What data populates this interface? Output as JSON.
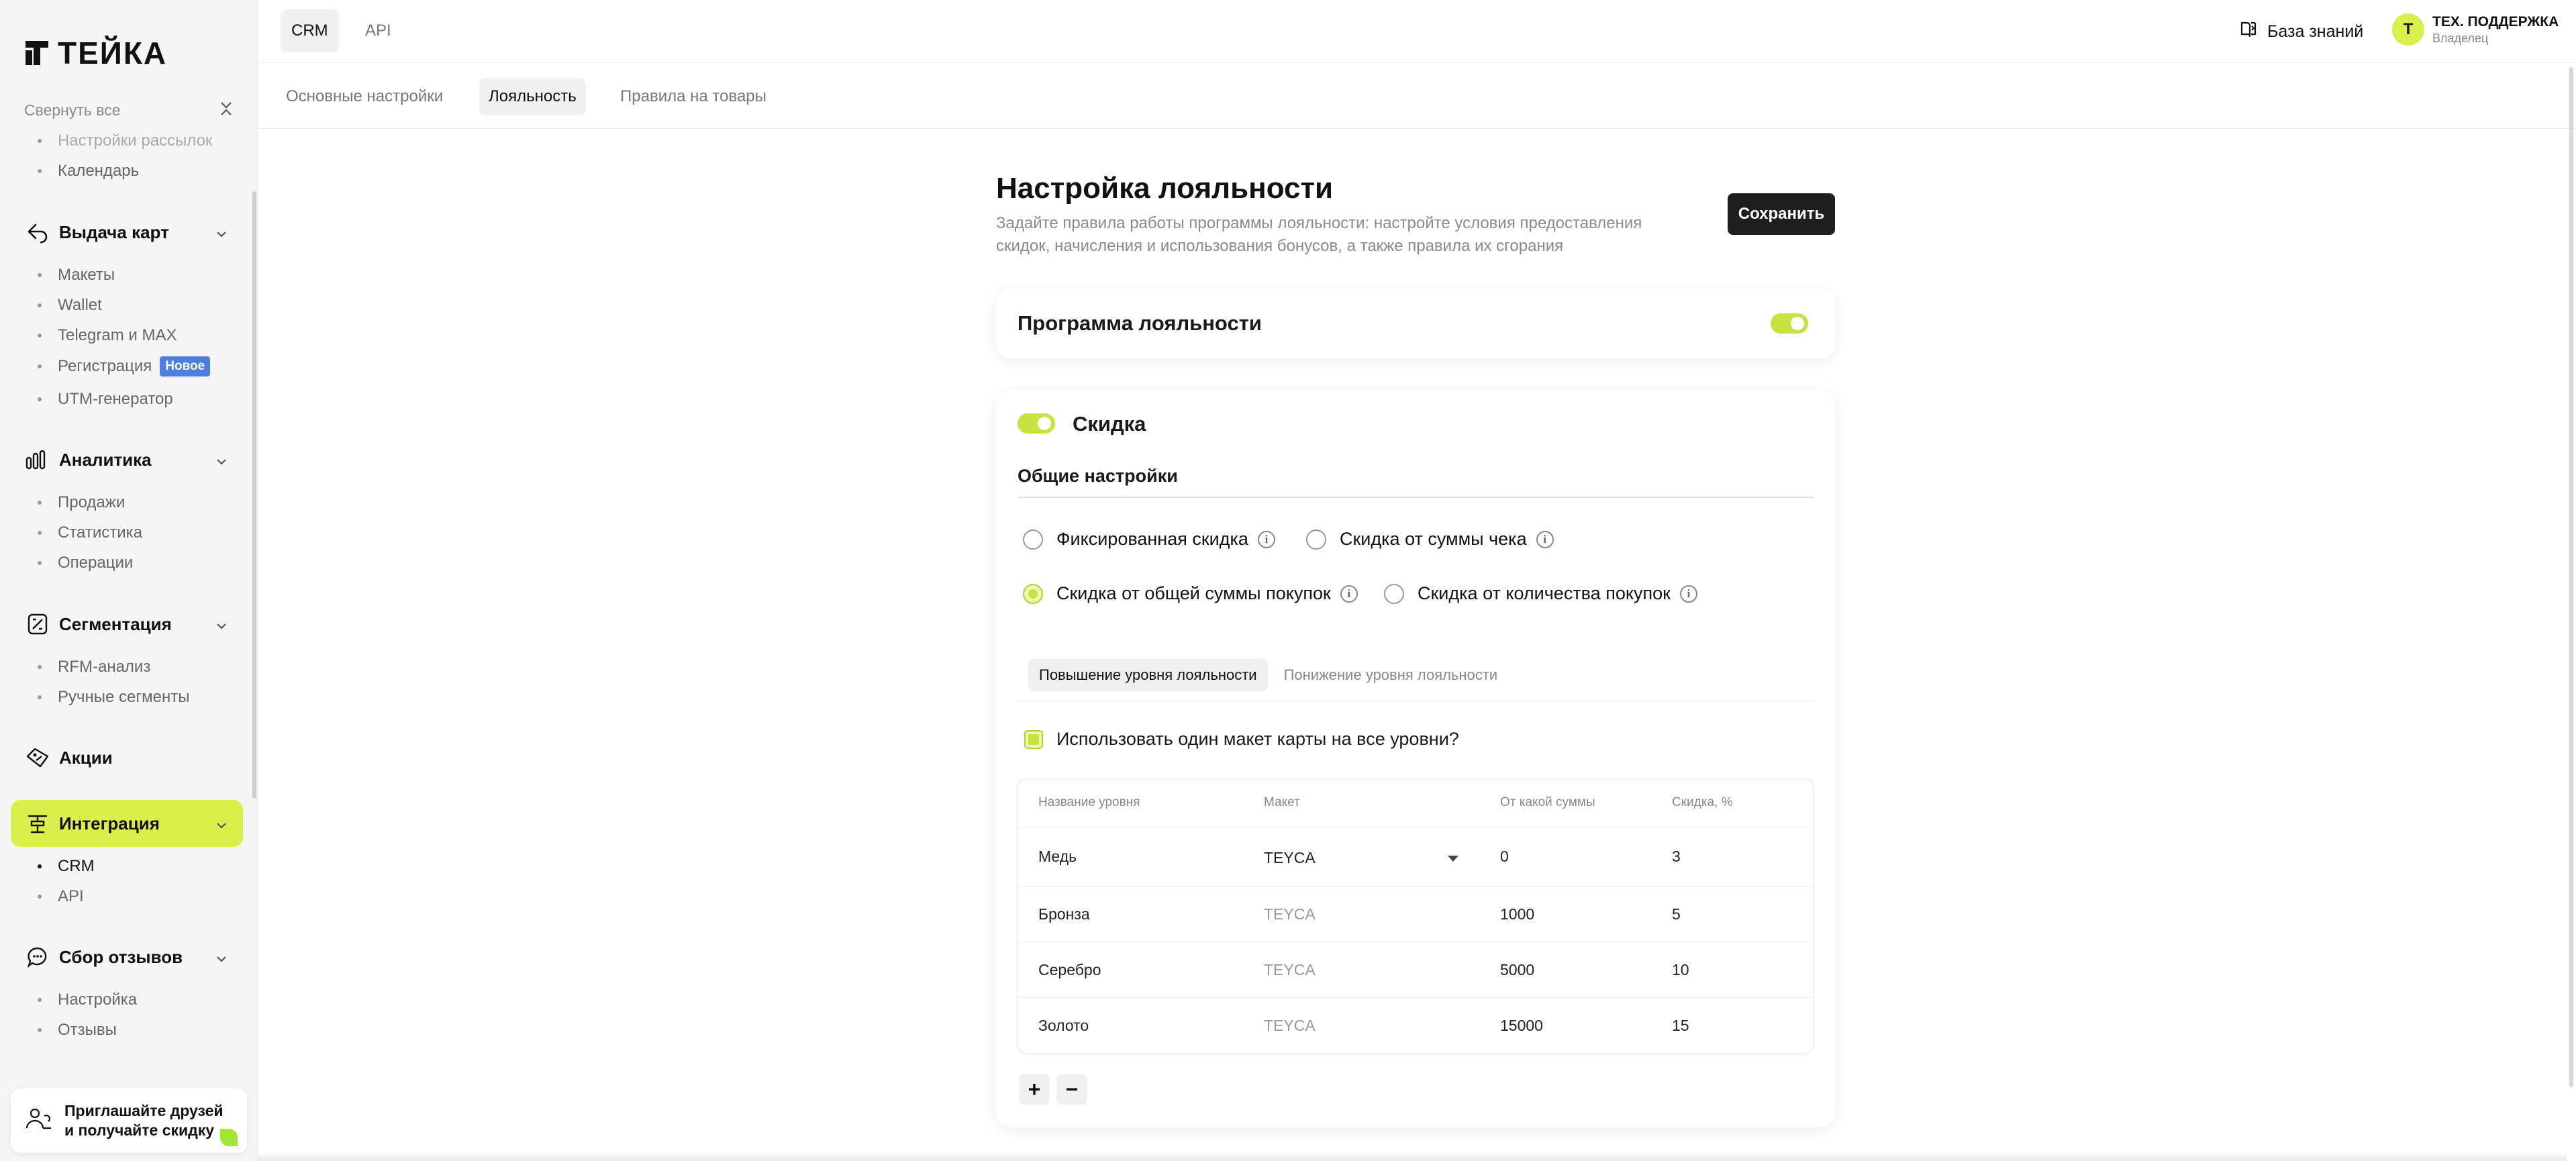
{
  "brand": {
    "name": "ТЕЙКА",
    "accent": "#d9ef4b",
    "toggle_color": "#c7e23e",
    "badge_color": "#4d7fe0"
  },
  "sidebar": {
    "collapse_all": "Свернуть все",
    "prev_items": [
      "Настройки рассылок",
      "Календарь"
    ],
    "groups": [
      {
        "label": "Выдача карт",
        "icon": "card-issue-icon",
        "items": [
          "Макеты",
          "Wallet",
          "Telegram и MAX",
          "Регистрация",
          "UTM-генератор"
        ],
        "badge": "Новое"
      },
      {
        "label": "Аналитика",
        "icon": "analytics-icon",
        "items": [
          "Продажи",
          "Статистика",
          "Операции"
        ]
      },
      {
        "label": "Сегментация",
        "icon": "segmentation-icon",
        "items": [
          "RFM-анализ",
          "Ручные сегменты"
        ]
      },
      {
        "label": "Акции",
        "icon": "promo-icon",
        "items": []
      },
      {
        "label": "Интеграция",
        "icon": "integration-icon",
        "items": [
          "CRM",
          "API"
        ],
        "active": true,
        "active_item": "CRM"
      },
      {
        "label": "Сбор отзывов",
        "icon": "reviews-icon",
        "items": [
          "Настройка",
          "Отзывы"
        ]
      }
    ],
    "invite": {
      "line1": "Приглашайте друзей",
      "line2": "и получайте скидку"
    }
  },
  "topbar": {
    "tabs": [
      "CRM",
      "API"
    ],
    "active_tab": "CRM",
    "knowledge_base": "База знаний",
    "user": {
      "initial": "Т",
      "name": "ТЕХ. ПОДДЕРЖКА",
      "role": "Владелец"
    }
  },
  "subtabs": [
    "Основные настройки",
    "Лояльность",
    "Правила на товары"
  ],
  "page": {
    "title": "Настройка лояльности",
    "subtitle": "Задайте правила работы программы лояльности: настройте условия предоставления скидок, начисления и использования бонусов, а также правила их сгорания",
    "save": "Сохранить"
  },
  "program_card": {
    "title": "Программа лояльности",
    "enabled": true
  },
  "discount_card": {
    "title": "Скидка",
    "enabled": true,
    "section": "Общие настройки",
    "options": [
      {
        "label": "Фиксированная скидка",
        "selected": false
      },
      {
        "label": "Скидка от суммы чека",
        "selected": false
      },
      {
        "label": "Скидка от общей суммы покупок",
        "selected": true
      },
      {
        "label": "Скидка от количества покупок",
        "selected": false
      }
    ],
    "level_tabs": [
      "Повышение уровня лояльности",
      "Понижение уровня лояльности"
    ],
    "same_layout_label": "Использовать один макет карты на все уровни?",
    "same_layout_checked": true,
    "table": {
      "headers": [
        "Название уровня",
        "Макет",
        "От какой суммы",
        "Скидка, %"
      ],
      "rows": [
        [
          "Медь",
          "TEYCA",
          "0",
          "3"
        ],
        [
          "Бронза",
          "TEYCA",
          "1000",
          "5"
        ],
        [
          "Серебро",
          "TEYCA",
          "5000",
          "10"
        ],
        [
          "Золото",
          "TEYCA",
          "15000",
          "15"
        ]
      ]
    },
    "add": "+",
    "remove": "−"
  }
}
